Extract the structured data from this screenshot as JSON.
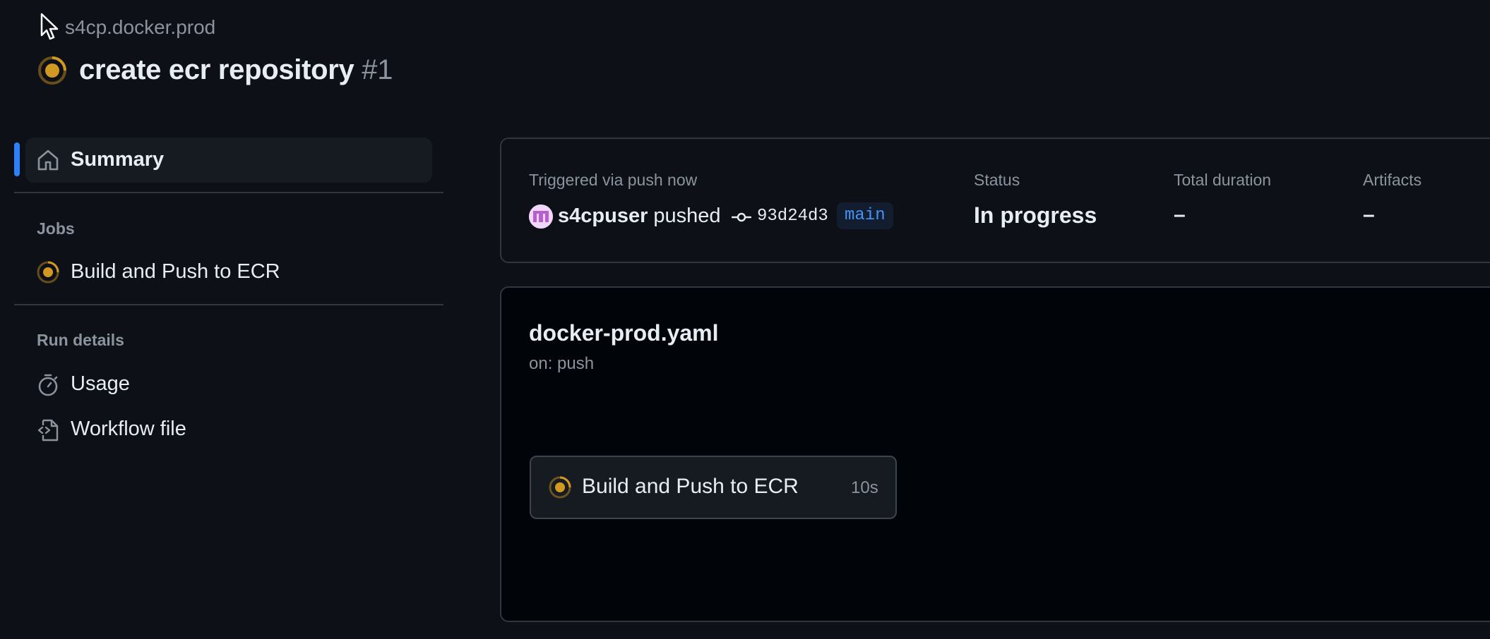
{
  "header": {
    "repo": "s4cp.docker.prod",
    "run_title": "create ecr repository",
    "run_number": "#1"
  },
  "colors": {
    "in_progress": "#d29922",
    "accent": "#2f81f7",
    "branch_text": "#4493f8"
  },
  "sidebar": {
    "summary_label": "Summary",
    "jobs_heading": "Jobs",
    "jobs": [
      {
        "label": "Build and Push to ECR",
        "icon": "in-progress-icon"
      }
    ],
    "run_details_heading": "Run details",
    "run_details": [
      {
        "label": "Usage",
        "icon": "stopwatch-icon"
      },
      {
        "label": "Workflow file",
        "icon": "file-code-icon"
      }
    ]
  },
  "summary": {
    "trigger_label": "Triggered via push now",
    "actor": "s4cpuser",
    "action": "pushed",
    "commit_sha": "93d24d3",
    "branch": "main",
    "status_label": "Status",
    "status_value": "In progress",
    "duration_label": "Total duration",
    "duration_value": "–",
    "artifacts_label": "Artifacts",
    "artifacts_value": "–"
  },
  "workflow": {
    "file": "docker-prod.yaml",
    "trigger": "on: push",
    "jobs": [
      {
        "name": "Build and Push to ECR",
        "duration": "10s",
        "status": "in_progress"
      }
    ]
  }
}
